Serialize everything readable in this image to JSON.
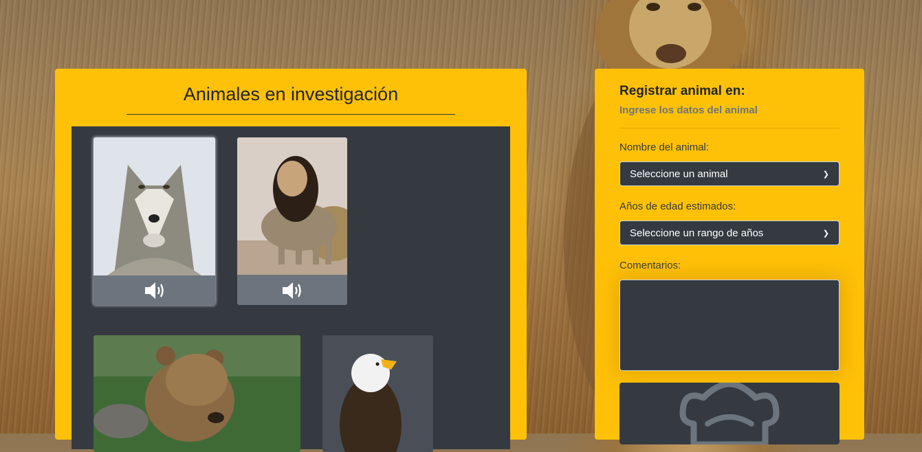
{
  "gallery": {
    "title": "Animales en investigación",
    "animals": [
      {
        "name": "Lobo",
        "sound_icon": "speaker-icon"
      },
      {
        "name": "León",
        "sound_icon": "speaker-icon"
      },
      {
        "name": "Oso",
        "sound_icon": "speaker-icon"
      },
      {
        "name": "Águila",
        "sound_icon": "speaker-icon"
      }
    ]
  },
  "form": {
    "title": "Registrar animal en:",
    "subtitle": "Ingrese los datos del animal",
    "name_label": "Nombre del animal:",
    "name_select": "Seleccione un animal",
    "age_label": "Años de edad estimados:",
    "age_select": "Seleccione un rango de años",
    "comments_label": "Comentarios:",
    "comments_value": "",
    "preview_icon": "lion-icon"
  },
  "colors": {
    "panel": "#ffc107",
    "dark": "#343a40",
    "card_footer": "#6c757d"
  }
}
